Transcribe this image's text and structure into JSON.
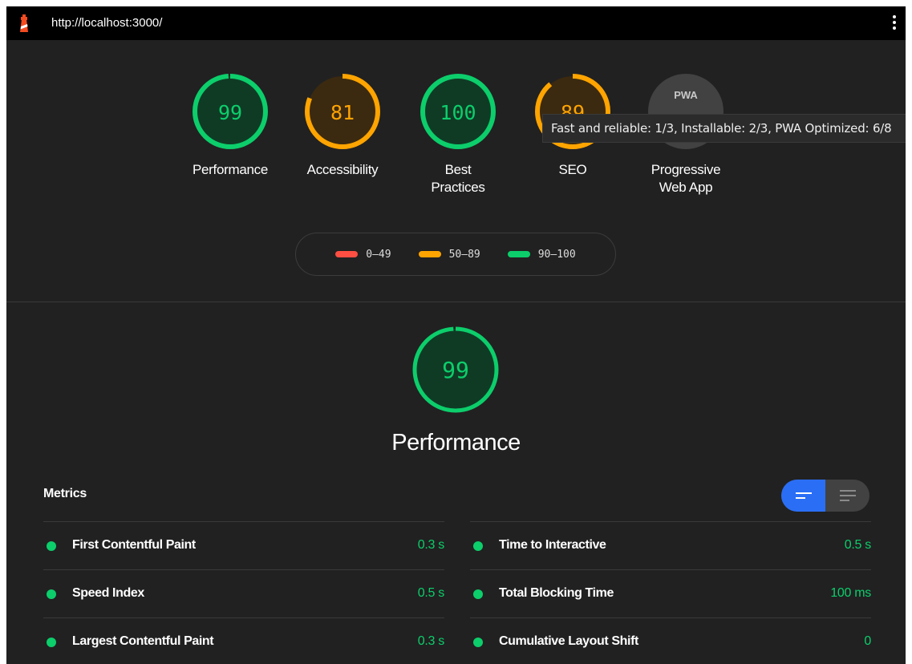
{
  "topbar": {
    "url": "http://localhost:3000/"
  },
  "colors": {
    "pass": "#0cce6b",
    "average": "#ffa400",
    "fail": "#ff4e42",
    "pwa_gray": "#424242",
    "accent": "#2a6ef5"
  },
  "gauges": [
    {
      "score": "99",
      "label": "Performance",
      "status": "pass",
      "fill": 0.99
    },
    {
      "score": "81",
      "label": "Accessibility",
      "status": "average",
      "fill": 0.81
    },
    {
      "score": "100",
      "label_line1": "Best",
      "label_line2": "Practices",
      "status": "pass",
      "fill": 1.0
    },
    {
      "score": "89",
      "label": "SEO",
      "status": "average",
      "fill": 0.89
    },
    {
      "badge": "PWA",
      "label_line1": "Progressive",
      "label_line2": "Web App",
      "status": "pwa"
    }
  ],
  "tooltip": {
    "text": "Fast and reliable: 1/3, Installable: 2/3, PWA Optimized: 6/8"
  },
  "legend": [
    {
      "range": "0–49",
      "color": "#ff4e42"
    },
    {
      "range": "50–89",
      "color": "#ffa400"
    },
    {
      "range": "90–100",
      "color": "#0cce6b"
    }
  ],
  "performance": {
    "score": "99",
    "fill": 0.99,
    "title": "Performance"
  },
  "metrics": {
    "heading": "Metrics",
    "left": [
      {
        "name": "First Contentful Paint",
        "value": "0.3 s"
      },
      {
        "name": "Speed Index",
        "value": "0.5 s"
      },
      {
        "name": "Largest Contentful Paint",
        "value": "0.3 s"
      }
    ],
    "right": [
      {
        "name": "Time to Interactive",
        "value": "0.5 s"
      },
      {
        "name": "Total Blocking Time",
        "value": "100 ms"
      },
      {
        "name": "Cumulative Layout Shift",
        "value": "0"
      }
    ]
  }
}
